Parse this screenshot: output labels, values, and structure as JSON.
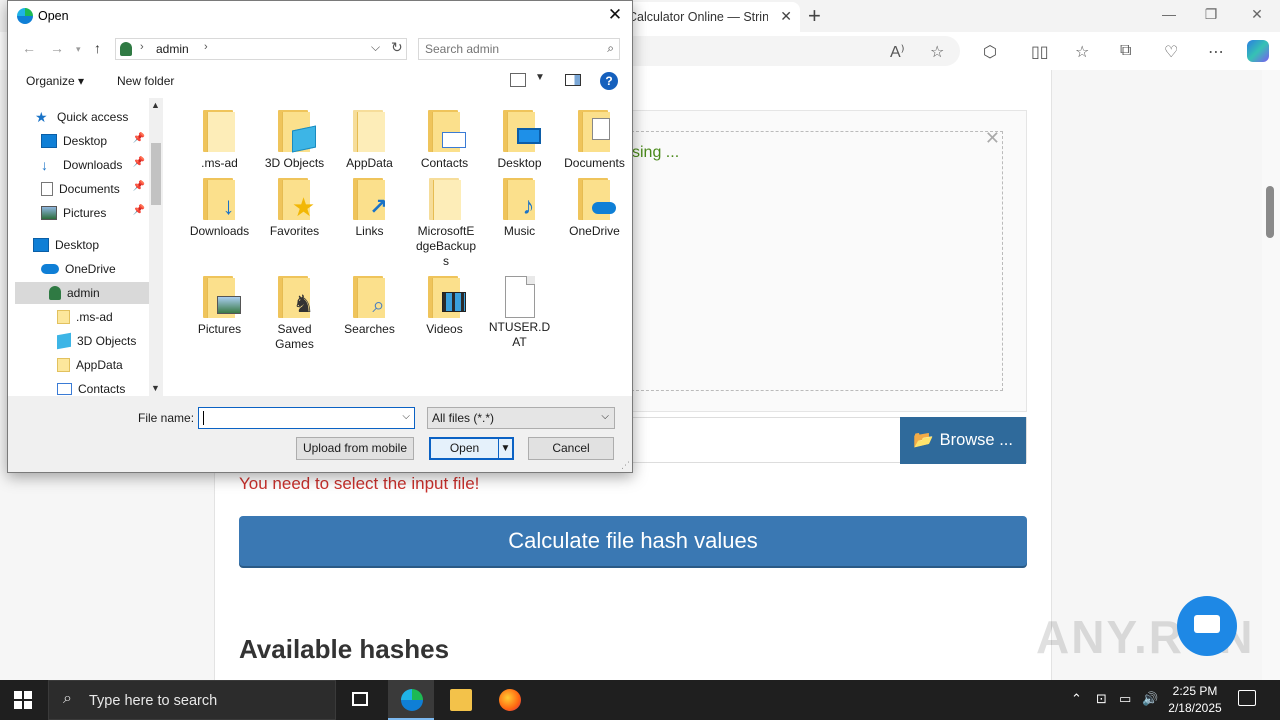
{
  "browser": {
    "tab_title": "Calculator Online — String",
    "tab_close": "✕",
    "new_tab": "+",
    "minimize": "—",
    "restore": "❐",
    "close": "✕"
  },
  "page": {
    "drop_text": "sing ...",
    "browse_label": "Browse ...",
    "error": "You need to select the input file!",
    "calculate_label": "Calculate file hash values",
    "available_title": "Available hashes",
    "watermark": "ANY.RUN"
  },
  "dialog": {
    "title": "Open",
    "close": "✕",
    "path": {
      "segment": "admin"
    },
    "search": {
      "placeholder": "Search admin"
    },
    "organize_label": "Organize ▾",
    "new_folder_label": "New folder",
    "help": "?",
    "nav_items": [
      {
        "label": "Quick access",
        "icon": "quick-access-icon",
        "pinned": false
      },
      {
        "label": "Desktop",
        "icon": "desktop-icon",
        "pinned": true
      },
      {
        "label": "Downloads",
        "icon": "downloads-icon",
        "pinned": true
      },
      {
        "label": "Documents",
        "icon": "documents-icon",
        "pinned": true
      },
      {
        "label": "Pictures",
        "icon": "pictures-icon",
        "pinned": true
      },
      {
        "label": "Desktop",
        "icon": "desktop-icon",
        "pinned": false
      },
      {
        "label": "OneDrive",
        "icon": "onedrive-icon",
        "pinned": false
      },
      {
        "label": "admin",
        "icon": "user-icon",
        "pinned": false,
        "selected": true
      },
      {
        "label": ".ms-ad",
        "icon": "folder-icon",
        "pinned": false
      },
      {
        "label": "3D Objects",
        "icon": "3d-objects-icon",
        "pinned": false
      },
      {
        "label": "AppData",
        "icon": "folder-icon",
        "pinned": false
      },
      {
        "label": "Contacts",
        "icon": "contacts-icon",
        "pinned": false
      }
    ],
    "pin_glyph": "📌",
    "files": [
      {
        "name": ".ms-ad",
        "icon": "folder-icon"
      },
      {
        "name": "3D Objects",
        "icon": "3d-objects-folder-icon"
      },
      {
        "name": "AppData",
        "icon": "hidden-folder-icon"
      },
      {
        "name": "Contacts",
        "icon": "contacts-folder-icon"
      },
      {
        "name": "Desktop",
        "icon": "desktop-folder-icon"
      },
      {
        "name": "Documents",
        "icon": "documents-folder-icon"
      },
      {
        "name": "Downloads",
        "icon": "downloads-folder-icon"
      },
      {
        "name": "Favorites",
        "icon": "favorites-folder-icon"
      },
      {
        "name": "Links",
        "icon": "links-folder-icon"
      },
      {
        "name": "MicrosoftEdgeBackups",
        "icon": "hidden-folder-icon"
      },
      {
        "name": "Music",
        "icon": "music-folder-icon"
      },
      {
        "name": "OneDrive",
        "icon": "onedrive-folder-icon"
      },
      {
        "name": "Pictures",
        "icon": "pictures-folder-icon"
      },
      {
        "name": "Saved Games",
        "icon": "saved-games-folder-icon"
      },
      {
        "name": "Searches",
        "icon": "searches-folder-icon"
      },
      {
        "name": "Videos",
        "icon": "videos-folder-icon"
      },
      {
        "name": "NTUSER.DAT",
        "icon": "file-icon"
      }
    ],
    "file_name_label": "File name:",
    "file_name_value": "",
    "filter_value": "All files (*.*)",
    "upload_label": "Upload from mobile",
    "open_label": "Open",
    "cancel_label": "Cancel"
  },
  "taskbar": {
    "search_placeholder": "Type here to search",
    "time": "2:25 PM",
    "date": "2/18/2025"
  },
  "colors": {
    "accent_blue": "#3a78b3",
    "error_red": "#c9302c",
    "browse_blue": "#2f6a9b",
    "dialog_focus": "#0b62c4"
  }
}
